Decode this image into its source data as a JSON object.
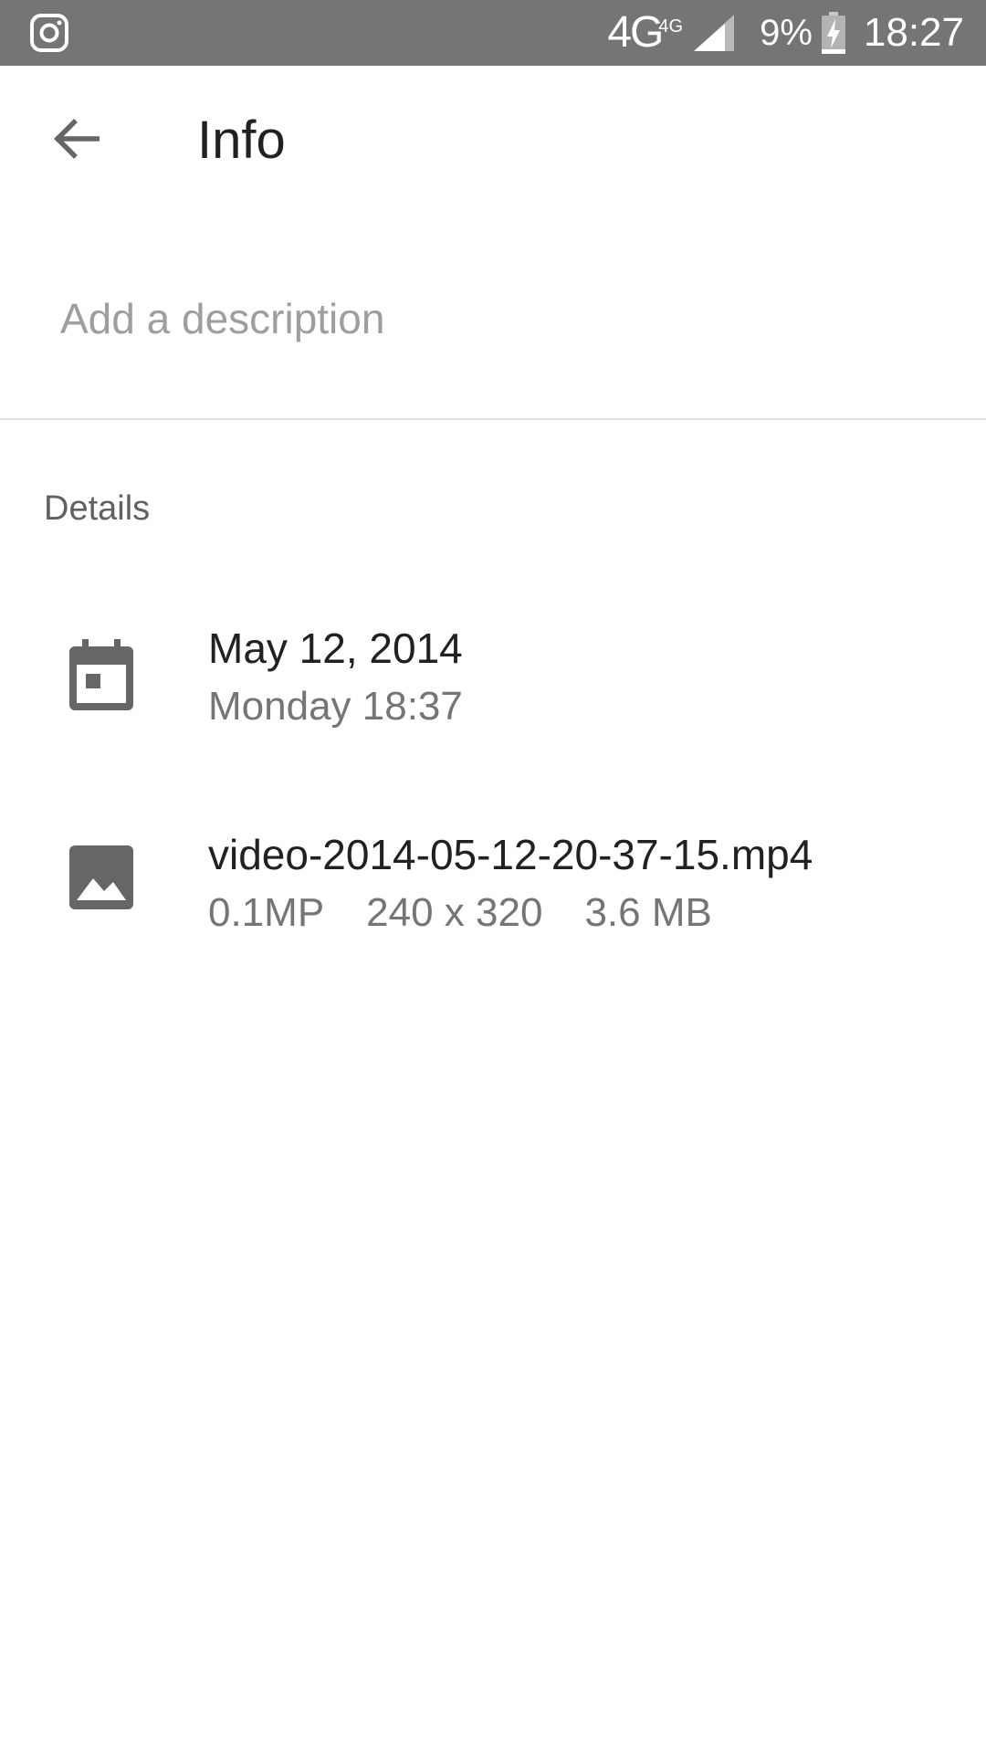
{
  "status_bar": {
    "network": "4G",
    "network_superscript": "4G",
    "battery": "9%",
    "time": "18:27",
    "icons": [
      "instagram-icon",
      "signal-icon",
      "battery-charging-icon"
    ]
  },
  "app_bar": {
    "title": "Info",
    "back_icon": "arrow-back-icon"
  },
  "description": {
    "placeholder": "Add a description",
    "value": ""
  },
  "details": {
    "header": "Details",
    "date": {
      "icon": "calendar-icon",
      "primary": "May 12, 2014",
      "secondary": "Monday 18:37"
    },
    "file": {
      "icon": "image-icon",
      "primary": "video-2014-05-12-20-37-15.mp4",
      "megapixels": "0.1MP",
      "resolution": "240 x 320",
      "size": "3.6 MB"
    }
  },
  "colors": {
    "status_bar": "#757575",
    "icon": "#666666",
    "text_primary": "#212121",
    "text_secondary": "#757575",
    "placeholder": "#9e9e9e",
    "divider": "#e0e0e0"
  }
}
